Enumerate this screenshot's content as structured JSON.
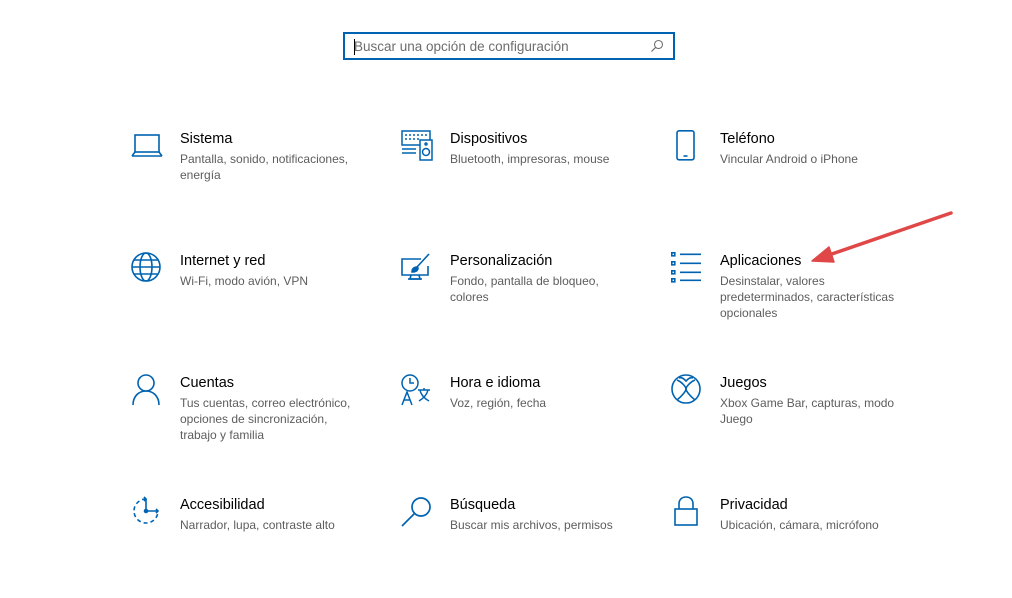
{
  "search": {
    "placeholder": "Buscar una opción de configuración"
  },
  "accent_color": "#0063b1",
  "annotation_color": "#e04848",
  "tiles": [
    {
      "title": "Sistema",
      "description": "Pantalla, sonido, notificaciones, energía",
      "icon": "laptop-icon"
    },
    {
      "title": "Dispositivos",
      "description": "Bluetooth, impresoras, mouse",
      "icon": "devices-icon"
    },
    {
      "title": "Teléfono",
      "description": "Vincular Android o iPhone",
      "icon": "phone-icon"
    },
    {
      "title": "Internet y red",
      "description": "Wi-Fi, modo avión, VPN",
      "icon": "globe-icon"
    },
    {
      "title": "Personalización",
      "description": "Fondo, pantalla de bloqueo, colores",
      "icon": "paintbrush-icon"
    },
    {
      "title": "Aplicaciones",
      "description": "Desinstalar, valores predeterminados, características opcionales",
      "icon": "app-list-icon"
    },
    {
      "title": "Cuentas",
      "description": "Tus cuentas, correo electrónico, opciones de sincronización, trabajo y familia",
      "icon": "person-icon"
    },
    {
      "title": "Hora e idioma",
      "description": "Voz, región, fecha",
      "icon": "time-language-icon"
    },
    {
      "title": "Juegos",
      "description": "Xbox Game Bar, capturas, modo Juego",
      "icon": "xbox-icon"
    },
    {
      "title": "Accesibilidad",
      "description": "Narrador, lupa, contraste alto",
      "icon": "accessibility-icon"
    },
    {
      "title": "Búsqueda",
      "description": "Buscar mis archivos, permisos",
      "icon": "search-category-icon"
    },
    {
      "title": "Privacidad",
      "description": "Ubicación, cámara, micrófono",
      "icon": "lock-icon"
    }
  ]
}
